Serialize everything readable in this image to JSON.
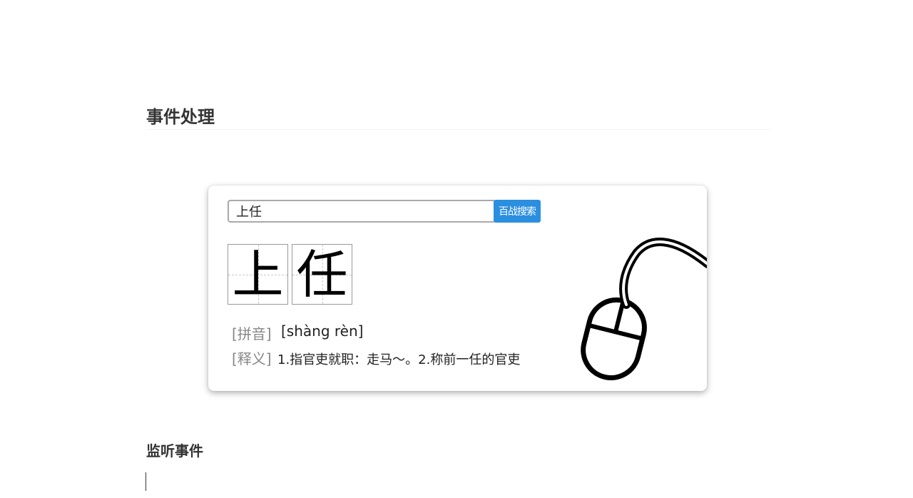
{
  "page": {
    "section_title": "事件处理",
    "next_section_title": "监听事件"
  },
  "search": {
    "value": "上任",
    "button_label": "百战搜索"
  },
  "result": {
    "characters": [
      "上",
      "任"
    ],
    "pinyin_label": "[拼音]",
    "pinyin": "[shàng rèn]",
    "meaning_label": "[释义]",
    "meaning": "1.指官吏就职：走马～。2.称前一任的官吏"
  },
  "icons": {
    "illustration": "mouse-icon"
  },
  "colors": {
    "button": "#2b8fe0",
    "label": "#888888"
  }
}
